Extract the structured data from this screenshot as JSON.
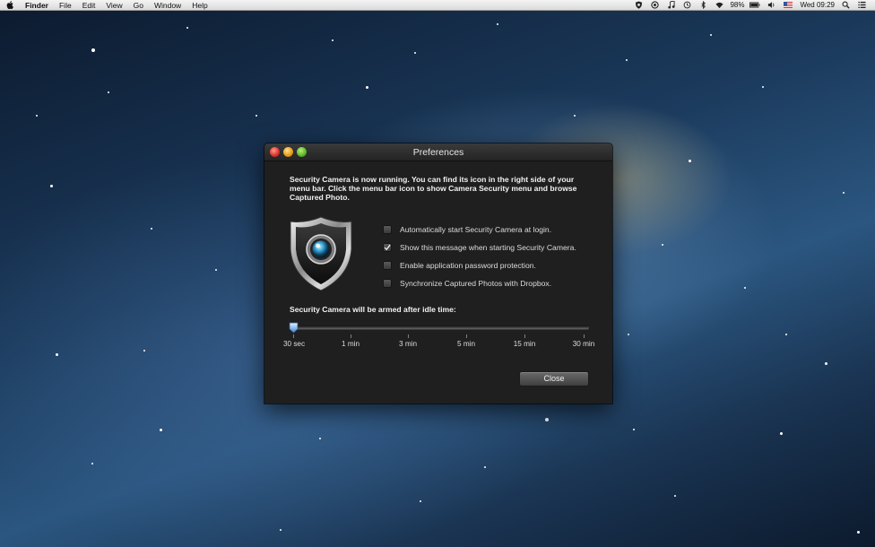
{
  "menubar": {
    "app_name": "Finder",
    "items": [
      "File",
      "Edit",
      "View",
      "Go",
      "Window",
      "Help"
    ],
    "battery": "98%",
    "clock": "Wed 09:29",
    "icons": [
      "shield-icon",
      "camera-icon",
      "music-icon",
      "time-machine-icon",
      "bluetooth-icon",
      "wifi-icon",
      "battery-icon",
      "volume-icon",
      "flag-icon",
      "search-icon",
      "list-icon"
    ]
  },
  "window": {
    "title": "Preferences",
    "message": "Security Camera is now running. You can find its icon in the right side of your menu bar. Click the menu bar icon to show Camera Security menu and browse Captured Photo.",
    "options": [
      {
        "label": "Automatically start Security Camera at login.",
        "checked": false
      },
      {
        "label": "Show this message when starting Security Camera.",
        "checked": true
      },
      {
        "label": "Enable application password protection.",
        "checked": false
      },
      {
        "label": "Synchronize Captured Photos with Dropbox.",
        "checked": false
      }
    ],
    "slider": {
      "title": "Security Camera will be armed after idle time:",
      "ticks": [
        "30 sec",
        "1 min",
        "3 min",
        "5 min",
        "15 min",
        "30 min"
      ],
      "selected": "30 sec"
    },
    "close_label": "Close"
  }
}
